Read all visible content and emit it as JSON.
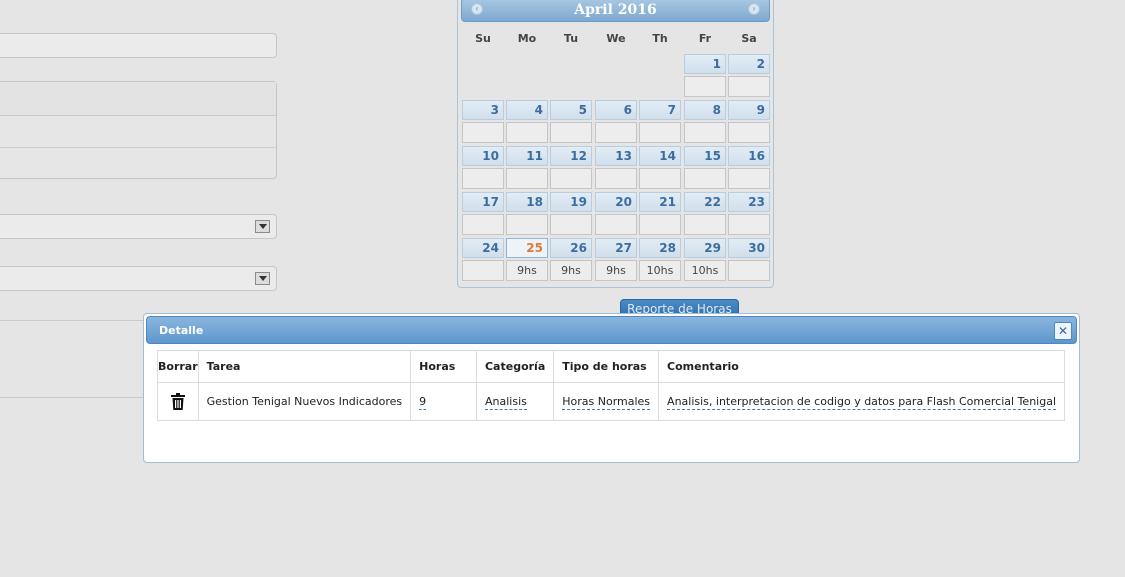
{
  "calendar": {
    "title": "April 2016",
    "prev_icon": "‹",
    "next_icon": "›",
    "weekdays": [
      "Su",
      "Mo",
      "Tu",
      "We",
      "Th",
      "Fr",
      "Sa"
    ],
    "weeks": [
      [
        null,
        null,
        null,
        null,
        null,
        {
          "day": "1",
          "hours": ""
        },
        {
          "day": "2",
          "hours": ""
        }
      ],
      [
        {
          "day": "3",
          "hours": ""
        },
        {
          "day": "4",
          "hours": ""
        },
        {
          "day": "5",
          "hours": ""
        },
        {
          "day": "6",
          "hours": ""
        },
        {
          "day": "7",
          "hours": ""
        },
        {
          "day": "8",
          "hours": ""
        },
        {
          "day": "9",
          "hours": ""
        }
      ],
      [
        {
          "day": "10",
          "hours": ""
        },
        {
          "day": "11",
          "hours": ""
        },
        {
          "day": "12",
          "hours": ""
        },
        {
          "day": "13",
          "hours": ""
        },
        {
          "day": "14",
          "hours": ""
        },
        {
          "day": "15",
          "hours": ""
        },
        {
          "day": "16",
          "hours": ""
        }
      ],
      [
        {
          "day": "17",
          "hours": ""
        },
        {
          "day": "18",
          "hours": ""
        },
        {
          "day": "19",
          "hours": ""
        },
        {
          "day": "20",
          "hours": ""
        },
        {
          "day": "21",
          "hours": ""
        },
        {
          "day": "22",
          "hours": ""
        },
        {
          "day": "23",
          "hours": ""
        }
      ],
      [
        {
          "day": "24",
          "hours": ""
        },
        {
          "day": "25",
          "hours": "9hs",
          "today": true
        },
        {
          "day": "26",
          "hours": "9hs"
        },
        {
          "day": "27",
          "hours": "9hs"
        },
        {
          "day": "28",
          "hours": "10hs"
        },
        {
          "day": "29",
          "hours": "10hs"
        },
        {
          "day": "30",
          "hours": ""
        }
      ]
    ]
  },
  "report_button": "Reporte de Horas",
  "dialog": {
    "title": "Detalle",
    "close_icon": "✕",
    "columns": [
      "Borrar",
      "Tarea",
      "Horas",
      "Categoría",
      "Tipo de horas",
      "Comentario"
    ],
    "rows": [
      {
        "tarea": "Gestion Tenigal Nuevos Indicadores",
        "horas": "9",
        "categoria": "Analisis",
        "tipo": "Horas Normales",
        "comentario": "Analisis, interpretacion de codigo y datos para Flash Comercial Tenigal"
      }
    ]
  }
}
